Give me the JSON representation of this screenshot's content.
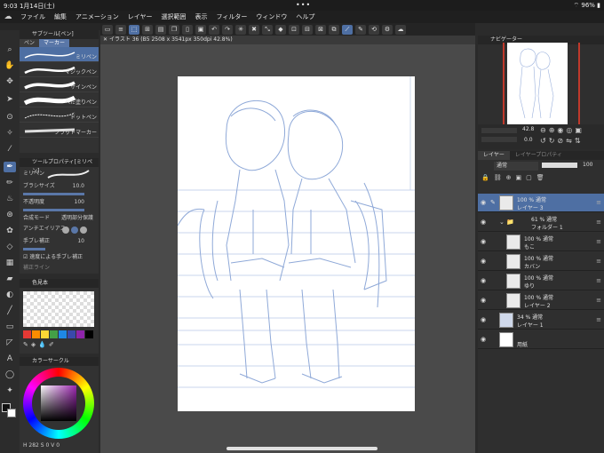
{
  "status": {
    "time": "9:03",
    "date": "1月14日(土)",
    "dots": "•••",
    "battery": "96%"
  },
  "menubar": {
    "items": [
      "ファイル",
      "編集",
      "アニメーション",
      "レイヤー",
      "選択範囲",
      "表示",
      "フィルター",
      "ウィンドウ",
      "ヘルプ"
    ]
  },
  "canvas": {
    "tab_title": "イラスト 36 (B5 2508 x 3541px 350dpi 42.8%)"
  },
  "subtool": {
    "header": "サブツール[ペン]",
    "tabs": [
      "ペン",
      "マーカー"
    ],
    "brushes": [
      "ミリペン",
      "マジックペン",
      "サインペン",
      "べた塗りペン",
      "ドットペン",
      "フラットマーカー"
    ]
  },
  "toolprop": {
    "header": "ツールプロパティ[ミリペン]",
    "brush_name": "ミリペン",
    "rows": [
      {
        "label": "ブラシサイズ",
        "value": "10.0"
      },
      {
        "label": "不透明度",
        "value": "100"
      },
      {
        "label": "合成モード",
        "value": "透明部分保護"
      },
      {
        "label": "アンチエイリアス",
        "value": ""
      },
      {
        "label": "手ブレ補正",
        "value": "10"
      },
      {
        "label": "速度による手ブレ補正",
        "value": ""
      },
      {
        "label": "補正ライン",
        "value": ""
      }
    ]
  },
  "colorset": {
    "header": "色見本",
    "colors": [
      "#e53935",
      "#fb8c00",
      "#fdd835",
      "#43a047",
      "#1e88e5",
      "#3949ab",
      "#8e24aa",
      "#000000",
      "#ffffff"
    ]
  },
  "colorwheel": {
    "header": "カラーサークル",
    "value_label": "H 282 S 0 V 0"
  },
  "navigator": {
    "header": "ナビゲーター",
    "zoom": "42.8",
    "angle": "0.0"
  },
  "layer_panel": {
    "tabs": [
      "レイヤー",
      "レイヤープロパティ"
    ],
    "blend_mode": "通常",
    "opacity": "100",
    "layers": [
      {
        "pct": "100 % 通常",
        "name": "レイヤー 3"
      },
      {
        "pct": "61 % 通常",
        "name": "フォルダー 1"
      },
      {
        "pct": "100 % 通常",
        "name": "もこ"
      },
      {
        "pct": "100 % 通常",
        "name": "カバン"
      },
      {
        "pct": "100 % 通常",
        "name": "ゆり"
      },
      {
        "pct": "100 % 通常",
        "name": "レイヤー 2"
      },
      {
        "pct": "34 % 通常",
        "name": "レイヤー 1"
      },
      {
        "pct": "",
        "name": "用紙"
      }
    ]
  }
}
